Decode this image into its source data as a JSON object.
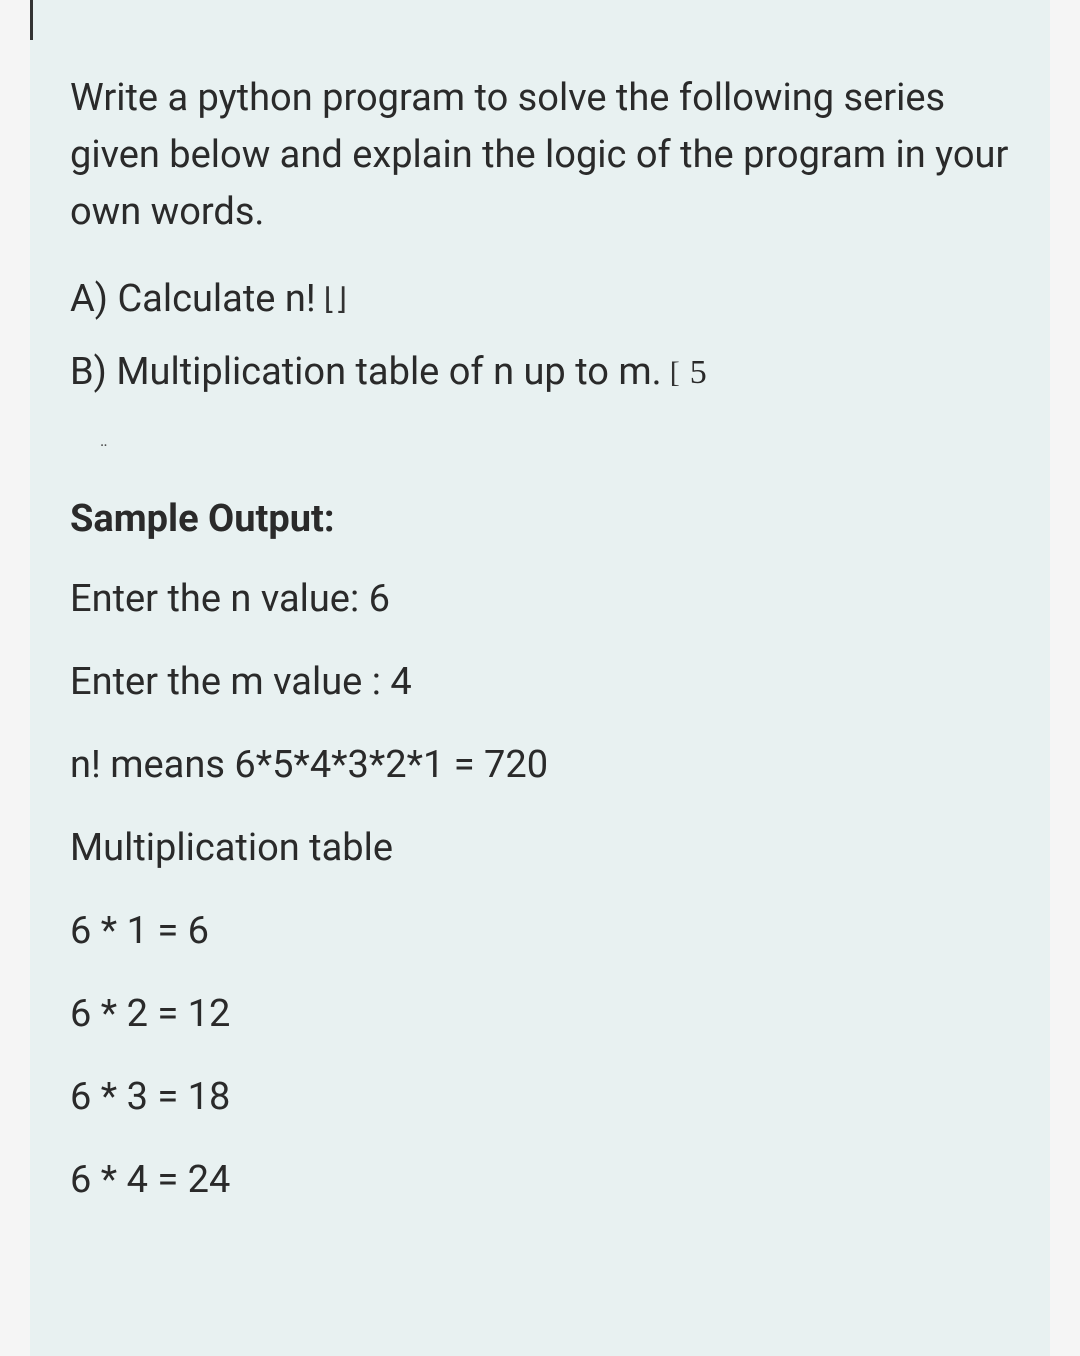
{
  "intro": "Write a python program to solve the following series given below and explain the logic of the program in your own words.",
  "part_a": {
    "label": "A) Calculate n!",
    "annotation": "⌊⌋"
  },
  "part_b": {
    "label": "B) Multiplication table of n up to m.",
    "annotation_bracket": "[",
    "annotation_number": "5"
  },
  "smudge": "‥",
  "sample_output_heading": "Sample Output:",
  "output": {
    "line1": "Enter the n value: 6",
    "line2": "Enter the m value : 4",
    "line3": "n! means 6*5*4*3*2*1 = 720",
    "line4": "Multiplication table",
    "line5": "6 * 1 = 6",
    "line6": "6 * 2 = 12",
    "line7": "6 * 3 = 18",
    "line8": "6 * 4 = 24"
  }
}
